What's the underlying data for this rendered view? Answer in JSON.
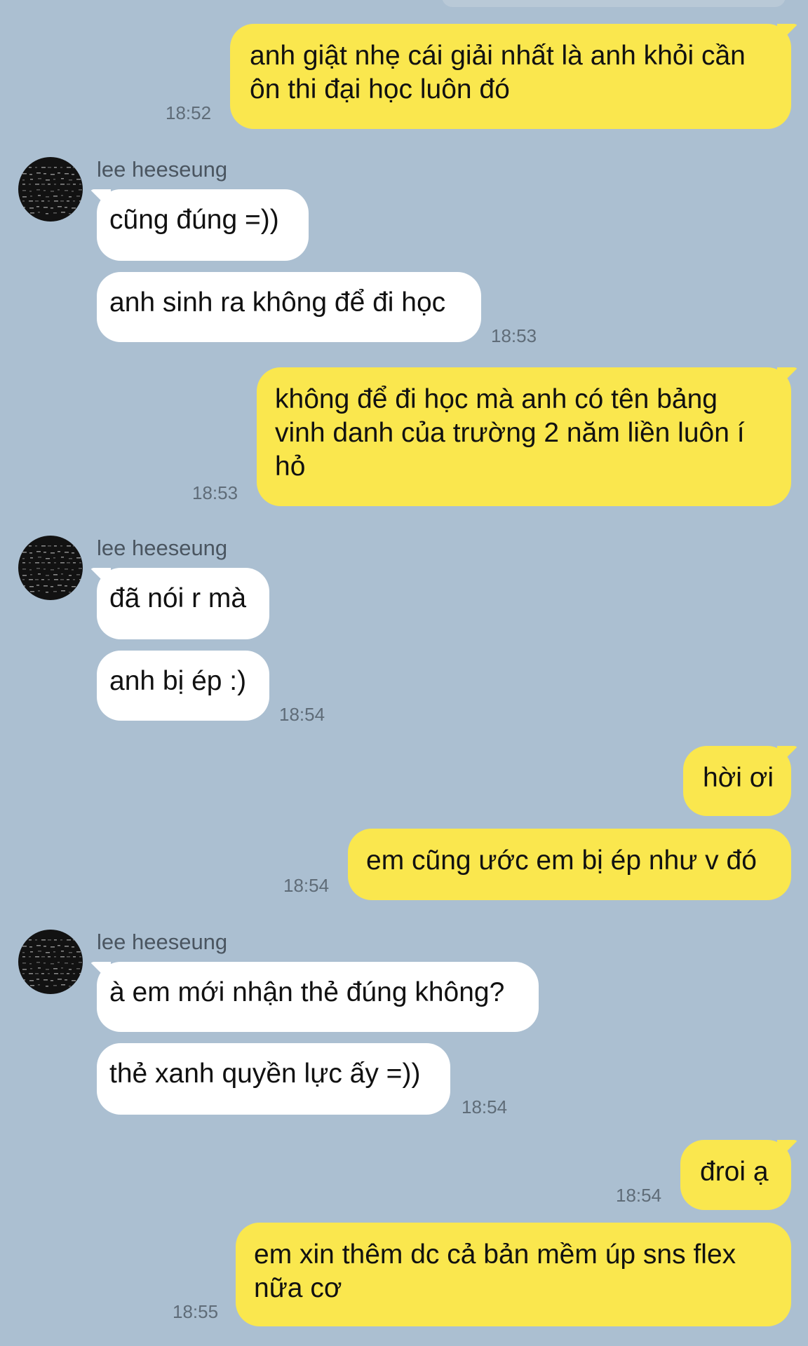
{
  "colors": {
    "background": "#abbfd1",
    "outgoing_bubble": "#fae74e",
    "incoming_bubble": "#ffffff",
    "timestamp": "#5f6c78",
    "sender_name": "#4a5560"
  },
  "contact": {
    "name": "lee heeseung",
    "avatar_icon": "dark-pattern-avatar"
  },
  "messages": [
    {
      "dir": "out",
      "text": "anh giật nhẹ cái giải nhất là anh khỏi cần\nôn thi đại học luôn đó",
      "time": "18:52"
    },
    {
      "dir": "in",
      "sender": "lee heeseung",
      "text": "cũng đúng =))"
    },
    {
      "dir": "in",
      "text": "anh sinh ra không để đi học",
      "time": "18:53"
    },
    {
      "dir": "out",
      "text": "không để đi học mà anh có tên bảng\nvinh danh của trường 2 năm liền luôn í\nhỏ",
      "time": "18:53"
    },
    {
      "dir": "in",
      "sender": "lee heeseung",
      "text": "đã nói r mà"
    },
    {
      "dir": "in",
      "text": "anh bị ép :)",
      "time": "18:54"
    },
    {
      "dir": "out",
      "text": "hời ơi"
    },
    {
      "dir": "out",
      "text": "em cũng ước em bị ép như v đó",
      "time": "18:54"
    },
    {
      "dir": "in",
      "sender": "lee heeseung",
      "text": "à em mới nhận thẻ đúng không?"
    },
    {
      "dir": "in",
      "text": "thẻ xanh quyền lực ấy =))",
      "time": "18:54"
    },
    {
      "dir": "out",
      "text": "đroi ạ",
      "time": "18:54"
    },
    {
      "dir": "out",
      "text": "em xin thêm dc cả bản mềm úp sns flex\nnữa cơ",
      "time": "18:55"
    }
  ]
}
